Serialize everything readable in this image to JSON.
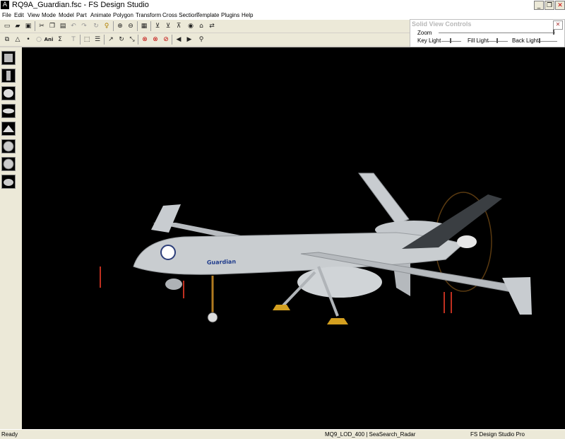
{
  "window": {
    "title": "RQ9A_Guardian.fsc - FS Design Studio",
    "icon": "app-icon",
    "controls": [
      "_",
      "❐",
      "✕"
    ]
  },
  "menu": [
    "File",
    "Edit",
    "View",
    "Mode",
    "Model",
    "Part",
    "Animate",
    "Polygon",
    "Transform",
    "Cross Section",
    "Template",
    "Plugins",
    "Help"
  ],
  "toolbar1": [
    "new-icon",
    "open-icon",
    "save-icon",
    "cut-icon",
    "copy-icon",
    "paste-icon",
    "undo-icon",
    "redo-icon",
    "refresh-icon",
    "key-icon",
    "zoom-in-icon",
    "zoom-out-icon",
    "grid-icon",
    "mirror-x-icon",
    "mirror-y-icon",
    "camera-icon",
    "home-icon",
    "link-icon"
  ],
  "toolbar2": [
    "select-icon",
    "triangle-icon",
    "point-icon",
    "circle-icon",
    "ani-icon",
    "sigma-icon",
    "text-icon",
    "box-select-icon",
    "lines-icon",
    "arrow-icon",
    "rotate-icon",
    "scale-icon",
    "stop1-icon",
    "stop2-icon",
    "stop3-icon",
    "prev-icon",
    "next-icon",
    "binoculars-icon"
  ],
  "toolbar2_labels": {
    "ani": "Ani",
    "sigma": "Σ"
  },
  "solid_view_controls": {
    "title": "Solid View Controls",
    "zoom": "Zoom",
    "key_light": "Key Light",
    "fill_light": "Fill Light",
    "back_light": "Back Light",
    "close": "✕"
  },
  "status": {
    "left": "Ready",
    "middle": "MQ9_LOD_400 | SeaSearch_Radar",
    "right": "FS Design Studio Pro"
  },
  "model": {
    "fuselage_label": "Guardian",
    "colors": {
      "fuselage": "#c9cdd0",
      "tail_dark": "#3a3e42",
      "viewport": "#000000"
    }
  }
}
